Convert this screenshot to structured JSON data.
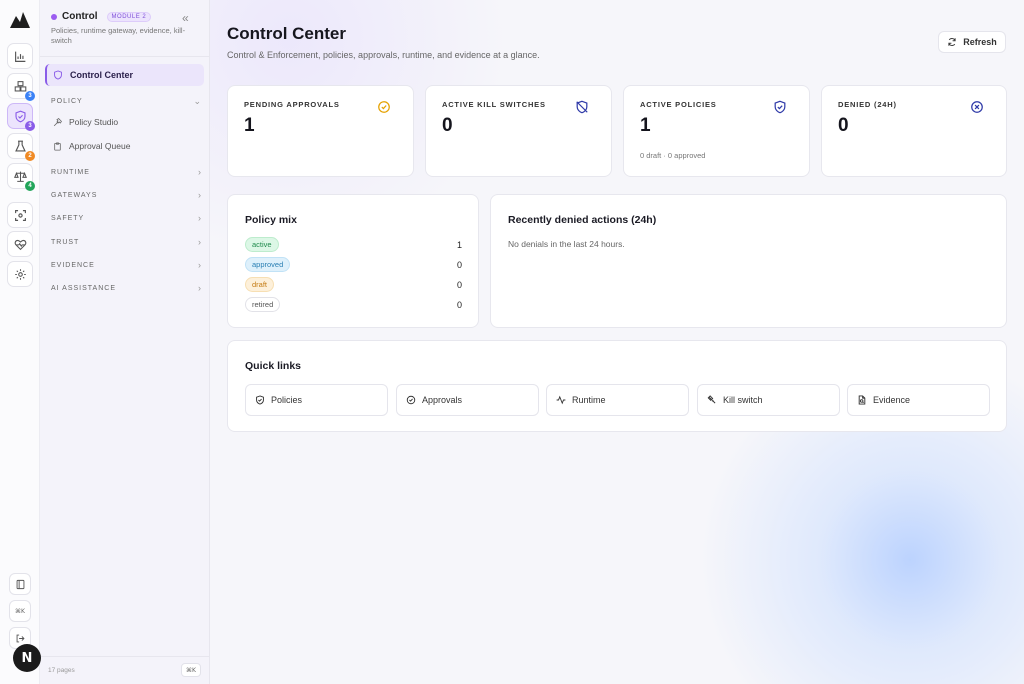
{
  "rail": {
    "badges": [
      "3",
      "3",
      "2",
      "4"
    ],
    "shortcut_label": "⌘K",
    "next_label": "N"
  },
  "sidebar": {
    "title": "Control",
    "module_tag": "MODULE 2",
    "subtitle": "Policies, runtime gateway, evidence, kill-switch",
    "active_item": "Control Center",
    "sections": [
      {
        "label": "POLICY",
        "expanded": true,
        "items": [
          "Policy Studio",
          "Approval Queue"
        ]
      },
      {
        "label": "RUNTIME"
      },
      {
        "label": "GATEWAYS"
      },
      {
        "label": "SAFETY"
      },
      {
        "label": "TRUST"
      },
      {
        "label": "EVIDENCE"
      },
      {
        "label": "AI ASSISTANCE"
      }
    ],
    "footer_pages": "17 pages",
    "footer_shortcut": "⌘K"
  },
  "header": {
    "title": "Control Center",
    "subtitle": "Control & Enforcement, policies, approvals, runtime, and evidence at a glance.",
    "refresh_label": "Refresh"
  },
  "stats": [
    {
      "label": "PENDING APPROVALS",
      "value": "1",
      "icon": "check-circle-icon",
      "color": "#e5a100"
    },
    {
      "label": "ACTIVE KILL SWITCHES",
      "value": "0",
      "icon": "shield-off-icon",
      "color": "#2f3aa8"
    },
    {
      "label": "ACTIVE POLICIES",
      "value": "1",
      "note": "0 draft · 0 approved",
      "icon": "shield-check-icon",
      "color": "#2f3aa8"
    },
    {
      "label": "DENIED (24H)",
      "value": "0",
      "icon": "x-circle-icon",
      "color": "#2f3aa8"
    }
  ],
  "policy_mix": {
    "title": "Policy mix",
    "rows": [
      {
        "label": "active",
        "count": "1"
      },
      {
        "label": "approved",
        "count": "0"
      },
      {
        "label": "draft",
        "count": "0"
      },
      {
        "label": "retired",
        "count": "0"
      }
    ]
  },
  "denied": {
    "title": "Recently denied actions (24h)",
    "empty": "No denials in the last 24 hours."
  },
  "quick_links": {
    "title": "Quick links",
    "items": [
      "Policies",
      "Approvals",
      "Runtime",
      "Kill switch",
      "Evidence"
    ]
  }
}
